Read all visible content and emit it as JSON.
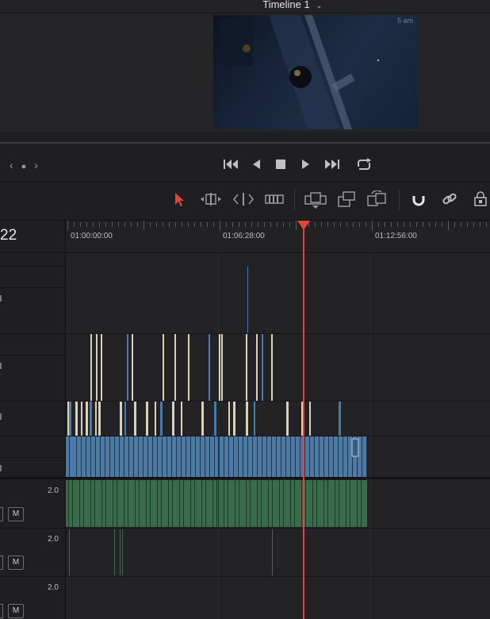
{
  "viewer": {
    "timeline_name": "Timeline 1",
    "frame_overlay_text": "5 am"
  },
  "transport": {
    "nav_prev": "‹",
    "nav_dot": "●",
    "nav_next": "›",
    "buttons": [
      "skip-to-start",
      "step-back",
      "stop",
      "play",
      "skip-to-end",
      "loop"
    ]
  },
  "tools": [
    "selection-mode",
    "trim-edit-mode",
    "dynamic-trim-mode",
    "blade-edit-mode",
    "insert-clip",
    "overwrite-clip",
    "replace-clip",
    "snapping",
    "linked-selection",
    "position-lock"
  ],
  "ruler": {
    "current_timecode": "22",
    "labels": [
      "01:00:00:00",
      "01:06:28:00",
      "01:12:56:00"
    ]
  },
  "audio_tracks": [
    {
      "volume": "2.0",
      "mute_label": "M"
    },
    {
      "volume": "2.0",
      "mute_label": "M"
    },
    {
      "volume": "2.0",
      "mute_label": "M"
    }
  ],
  "colors": {
    "playhead": "#e0443b",
    "video_clip": "#4a7aa8",
    "audio_clip": "#3a6b4c",
    "clip_marker": "#d8d2bc"
  }
}
